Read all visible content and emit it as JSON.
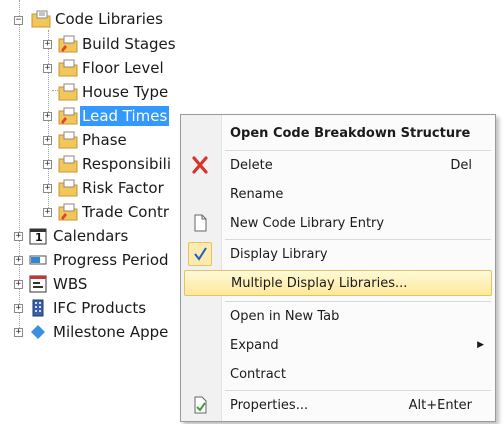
{
  "tree": {
    "nodes": [
      {
        "label": "Code Libraries",
        "icon": "folder-icon",
        "expanded": true
      },
      {
        "label": "Build Stages",
        "icon": "folder-edit-icon"
      },
      {
        "label": "Floor Level",
        "icon": "folder-icon"
      },
      {
        "label": "House Type",
        "icon": "folder-icon"
      },
      {
        "label": "Lead Times",
        "icon": "folder-edit-icon",
        "selected": true
      },
      {
        "label": "Phase",
        "icon": "folder-icon"
      },
      {
        "label": "Responsibili",
        "icon": "folder-icon"
      },
      {
        "label": "Risk Factor",
        "icon": "folder-icon"
      },
      {
        "label": "Trade Contr",
        "icon": "folder-edit-icon"
      },
      {
        "label": "Calendars",
        "icon": "calendar-icon",
        "calendar_day": "1"
      },
      {
        "label": "Progress Period",
        "icon": "progress-icon"
      },
      {
        "label": "WBS",
        "icon": "wbs-icon"
      },
      {
        "label": "IFC Products",
        "icon": "building-icon"
      },
      {
        "label": "Milestone Appe",
        "icon": "diamond-icon"
      }
    ]
  },
  "context_menu": {
    "items": [
      {
        "label": "Open Code Breakdown Structure",
        "bold": true
      },
      {
        "label": "Delete",
        "shortcut": "Del",
        "icon": "delete-x-icon"
      },
      {
        "label": "Rename"
      },
      {
        "label": "New Code Library Entry",
        "icon": "new-document-icon"
      },
      {
        "label": "Display Library",
        "icon": "checkmark-icon",
        "checked": true
      },
      {
        "label": "Multiple Display Libraries...",
        "highlighted": true
      },
      {
        "label": "Open in New Tab"
      },
      {
        "label": "Expand",
        "submenu": true
      },
      {
        "label": "Contract"
      },
      {
        "label": "Properties...",
        "shortcut": "Alt+Enter",
        "icon": "properties-icon"
      }
    ]
  },
  "colors": {
    "selection": "#3399ff",
    "highlight": "#fde99a",
    "delete_red": "#d9342b",
    "check_blue": "#1e5fbf",
    "folder": "#f3c65a"
  }
}
